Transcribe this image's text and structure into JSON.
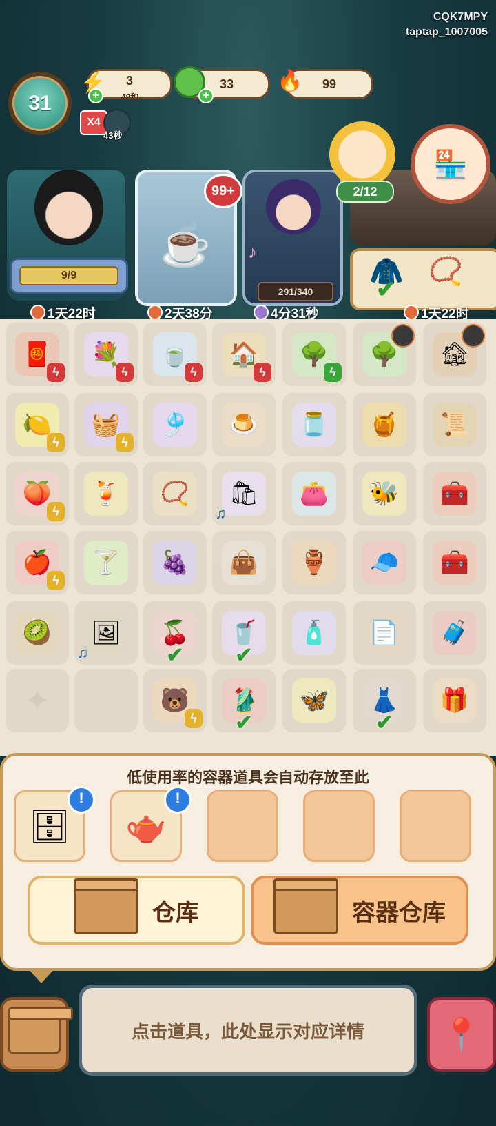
{
  "account": {
    "code": "CQK7MPY",
    "user": "taptap_1007005"
  },
  "level": "31",
  "resources": {
    "energy": {
      "value": "3",
      "timer": "48秒",
      "icon": "lightning-icon"
    },
    "coins": {
      "value": "33",
      "icon": "jade-coin-icon"
    },
    "flame": {
      "value": "99",
      "icon": "blue-flame-icon"
    }
  },
  "boost": {
    "label": "X4",
    "timer": "43秒"
  },
  "cards": {
    "card1": {
      "progress": "9/9",
      "timer": "1天22时"
    },
    "card2": {
      "badge": "99+",
      "timer": "2天38分"
    },
    "card3": {
      "progress": "291/340",
      "timer": "4分31秒"
    },
    "card4": {
      "timer": "1天22时"
    }
  },
  "visitor": {
    "count": "2/12"
  },
  "board": {
    "rows": [
      [
        {
          "icon": "🧧",
          "bg": "#f0c9b8",
          "tag": "bolt-red"
        },
        {
          "icon": "💐",
          "bg": "#eadff0",
          "tag": "bolt-red"
        },
        {
          "icon": "🍵",
          "bg": "#dfeaf0",
          "tag": "bolt-red"
        },
        {
          "icon": "🏠",
          "bg": "#f0e0c0",
          "tag": "bolt-red"
        },
        {
          "icon": "🌳",
          "bg": "#d8ecc8",
          "tag": "bolt-green"
        },
        {
          "icon": "🌳",
          "bg": "#d8ecc8",
          "tag": "timer"
        },
        {
          "icon": "🏚",
          "bg": "#e8d4b8",
          "tag": "timer"
        }
      ],
      [
        {
          "icon": "🍋",
          "bg": "#f4f0b0",
          "tag": "bolt-yellow"
        },
        {
          "icon": "🧺",
          "bg": "#e4d8f0",
          "tag": "bolt-yellow"
        },
        {
          "icon": "🎐",
          "bg": "#eadcf2",
          "tag": ""
        },
        {
          "icon": "🍮",
          "bg": "#f0e0c8",
          "tag": ""
        },
        {
          "icon": "🫙",
          "bg": "#e8e0f0",
          "tag": ""
        },
        {
          "icon": "🍯",
          "bg": "#f4e0b0",
          "tag": ""
        },
        {
          "icon": "📜",
          "bg": "#e8d8b8",
          "tag": ""
        }
      ],
      [
        {
          "icon": "🍑",
          "bg": "#f4d8d0",
          "tag": "bolt-yellow"
        },
        {
          "icon": "🍹",
          "bg": "#f4ecc0",
          "tag": ""
        },
        {
          "icon": "📿",
          "bg": "#f0e4c8",
          "tag": ""
        },
        {
          "icon": "🛍",
          "bg": "#ece4f0",
          "tag": "music"
        },
        {
          "icon": "👛",
          "bg": "#e0ecec",
          "tag": ""
        },
        {
          "icon": "🐝",
          "bg": "#f4ecc0",
          "tag": ""
        },
        {
          "icon": "🧰",
          "bg": "#f0d0c0",
          "tag": ""
        }
      ],
      [
        {
          "icon": "🍎",
          "bg": "#f4d0c8",
          "tag": "bolt-yellow"
        },
        {
          "icon": "🍸",
          "bg": "#e4f0c8",
          "tag": ""
        },
        {
          "icon": "🍇",
          "bg": "#e0d8ec",
          "tag": ""
        },
        {
          "icon": "👜",
          "bg": "#ece4d8",
          "tag": ""
        },
        {
          "icon": "🏺",
          "bg": "#f0dcc0",
          "tag": ""
        },
        {
          "icon": "🧢",
          "bg": "#f0d0c8",
          "tag": ""
        },
        {
          "icon": "🧰",
          "bg": "#f0d0c0",
          "tag": ""
        }
      ],
      [
        {
          "icon": "🥝",
          "bg": "#e8dcc0",
          "tag": ""
        },
        {
          "icon": "🖼",
          "bg": "#e4dcc8",
          "tag": "music"
        },
        {
          "icon": "🍒",
          "bg": "#f0d8d0",
          "tag": "check"
        },
        {
          "icon": "🥤",
          "bg": "#ece0f0",
          "tag": "check"
        },
        {
          "icon": "🧴",
          "bg": "#e8e0f0",
          "tag": ""
        },
        {
          "icon": "📄",
          "bg": "#e8dcc8",
          "tag": ""
        },
        {
          "icon": "🧳",
          "bg": "#f0d0c8",
          "tag": ""
        }
      ],
      [
        {
          "icon": "✦",
          "bg": "#e6dccc",
          "tag": ""
        },
        {
          "icon": "",
          "bg": "#e6dccc",
          "tag": ""
        },
        {
          "icon": "🐻",
          "bg": "#f0dcc0",
          "tag": "bolt-yellow"
        },
        {
          "icon": "🥻",
          "bg": "#f0d0c8",
          "tag": "check"
        },
        {
          "icon": "🦋",
          "bg": "#f4ecc0",
          "tag": ""
        },
        {
          "icon": "👗",
          "bg": "#e8dcd0",
          "tag": "check"
        },
        {
          "icon": "🎁",
          "bg": "#f0e0c8",
          "tag": ""
        }
      ]
    ]
  },
  "storage": {
    "title": "低使用率的容器道具会自动存放至此",
    "slots": [
      {
        "icon": "🗄",
        "alert": "!"
      },
      {
        "icon": "🫖",
        "alert": "!"
      },
      {
        "icon": "",
        "alert": ""
      },
      {
        "icon": "",
        "alert": ""
      },
      {
        "icon": "",
        "alert": ""
      }
    ],
    "warehouse_label": "仓库",
    "container_warehouse_label": "容器仓库"
  },
  "detail": {
    "hint": "点击道具，此处显示对应详情"
  },
  "colors": {
    "accent": "#c89a58",
    "panel": "#f6efe1",
    "check": "#2e9d2e"
  }
}
